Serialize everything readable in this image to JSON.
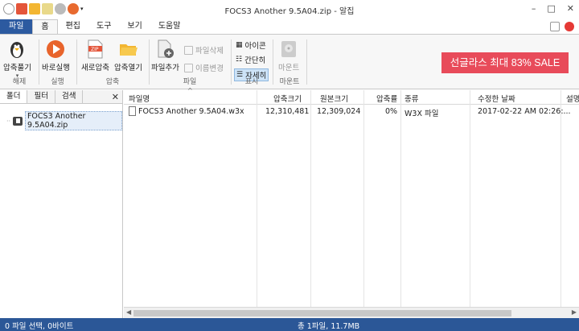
{
  "window": {
    "title": "FOCS3 Another 9.5A04.zip - 알집",
    "min": "–",
    "max": "□",
    "close": "✕"
  },
  "tabs": [
    "파일",
    "홈",
    "편집",
    "도구",
    "보기",
    "도움말"
  ],
  "ribbon": {
    "extract": {
      "label": "압축풀기",
      "group": "해제"
    },
    "run": {
      "label": "바로실행",
      "group": "실행"
    },
    "new_zip": {
      "label": "새로압축"
    },
    "open_zip": {
      "label": "압축열기"
    },
    "compress_group": "압축",
    "add_file": {
      "label": "파일추가"
    },
    "delete_file": "파일삭제",
    "rename": "이름변경",
    "file_group": "파일",
    "view_icon": "아이콘",
    "view_simple": "간단히",
    "view_detail": "자세히",
    "view_group": "표시",
    "mount": {
      "label": "마운트",
      "group": "마운트"
    },
    "ad": "선글라스 최대 83% SALE",
    "colors": {
      "ad_bg": "#e84b5a",
      "file_tab": "#2c5aa0",
      "status_bg": "#2b5797"
    }
  },
  "left_panel": {
    "tabs": [
      "폴더",
      "필터",
      "검색"
    ],
    "close": "✕",
    "tree_item": "FOCS3 Another 9.5A04.zip"
  },
  "list": {
    "columns": [
      "파일명",
      "압축크기",
      "원본크기",
      "압축률",
      "종류",
      "수정한 날짜",
      "설명"
    ],
    "rows": [
      {
        "name": "FOCS3 Another 9.5A04.w3x",
        "packed": "12,310,481",
        "original": "12,309,024",
        "ratio": "0%",
        "type": "W3X 파일",
        "modified": "2017-02-22 AM 02:26:..."
      }
    ]
  },
  "status": {
    "left": "0 파일 선택, 0바이트",
    "center": "총 1파일, 11.7MB"
  }
}
